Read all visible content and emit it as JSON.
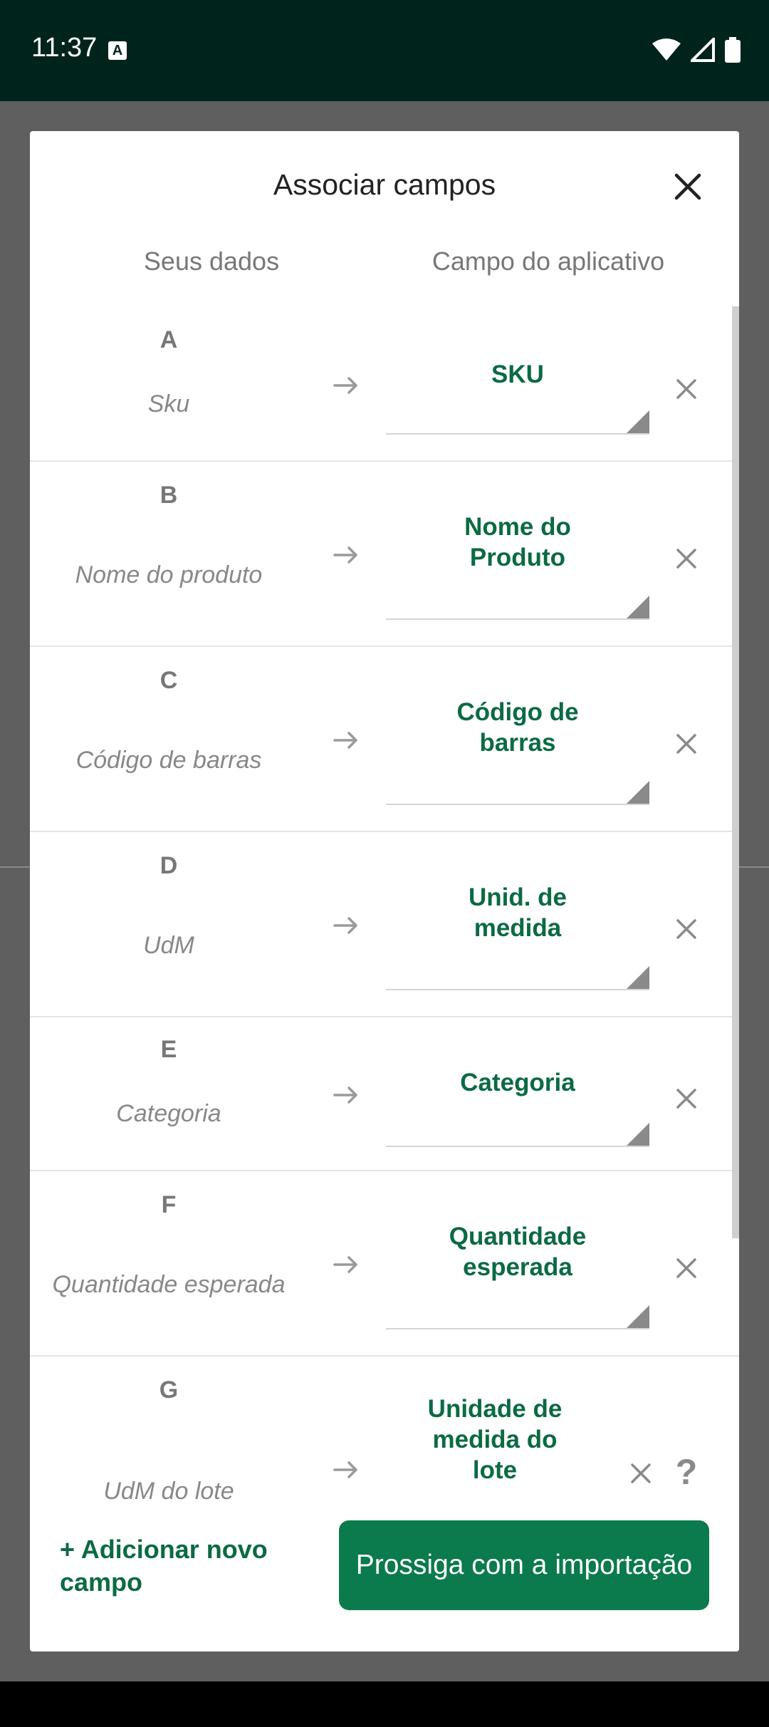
{
  "status": {
    "time": "11:37",
    "badge": "A"
  },
  "dialog": {
    "title": "Associar campos",
    "col_left": "Seus dados",
    "col_right": "Campo do aplicativo"
  },
  "rows": [
    {
      "letter": "A",
      "name": "Sku",
      "field": "SKU"
    },
    {
      "letter": "B",
      "name": "Nome do produto",
      "field": "Nome do\nProduto"
    },
    {
      "letter": "C",
      "name": "Código de barras",
      "field": "Código de\nbarras"
    },
    {
      "letter": "D",
      "name": "UdM",
      "field": "Unid. de\nmedida"
    },
    {
      "letter": "E",
      "name": "Categoria",
      "field": "Categoria"
    },
    {
      "letter": "F",
      "name": "Quantidade esperada",
      "field": "Quantidade\nesperada"
    },
    {
      "letter": "G",
      "name": "UdM do lote",
      "field": "Unidade de\nmedida do\nlote"
    }
  ],
  "help": "?",
  "footer": {
    "add_field": "+ Adicionar novo campo",
    "proceed": "Prossiga com a importação"
  },
  "colors": {
    "accent": "#0b6a44",
    "button": "#0b7a4c",
    "statusbar": "#00241b"
  }
}
